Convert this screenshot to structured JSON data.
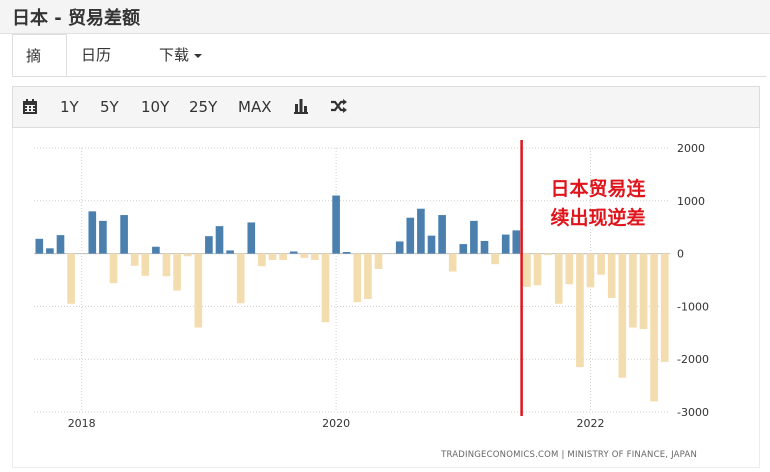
{
  "page": {
    "title": "日本 - 贸易差额"
  },
  "tabs": [
    {
      "label": "摘要",
      "active": true
    },
    {
      "label": "日历",
      "active": false
    },
    {
      "label": "下载",
      "active": false
    }
  ],
  "toolbar": {
    "calendar_icon": "calendar-icon",
    "ranges": [
      "1Y",
      "5Y",
      "10Y",
      "25Y",
      "MAX"
    ],
    "bar_icon": "bar-chart-icon",
    "shuffle_icon": "shuffle-icon"
  },
  "colors": {
    "positive": "#4a7fae",
    "negative": "#f3dcae",
    "annotation": "#e0141b"
  },
  "chart_data": {
    "type": "bar",
    "ylim": [
      -3000,
      2000
    ],
    "yticks": [
      2000,
      1000,
      0,
      -1000,
      -2000,
      -3000
    ],
    "xtick_labels": [
      {
        "label": "2018",
        "month_index": 4
      },
      {
        "label": "2020",
        "month_index": 28
      },
      {
        "label": "2022",
        "month_index": 52
      }
    ],
    "start": "2017-08",
    "values": [
      280,
      100,
      350,
      -950,
      0,
      800,
      620,
      -560,
      730,
      -230,
      -420,
      130,
      -430,
      -700,
      -50,
      -1400,
      330,
      520,
      60,
      -940,
      590,
      -240,
      -120,
      -120,
      40,
      -80,
      -120,
      -1300,
      1100,
      30,
      -920,
      -860,
      -290,
      0,
      230,
      680,
      850,
      340,
      730,
      -340,
      180,
      620,
      240,
      -200,
      360,
      440,
      -630,
      -600,
      -30,
      -950,
      -580,
      -2150,
      -640,
      -400,
      -840,
      -2350,
      -1400,
      -1430,
      -2800,
      -2050
    ],
    "annotation": {
      "text_line1": "日本贸易连",
      "text_line2": "续出现逆差",
      "marker_month_index": 46
    },
    "source": "TRADINGECONOMICS.COM  |  MINISTRY OF FINANCE, JAPAN"
  }
}
